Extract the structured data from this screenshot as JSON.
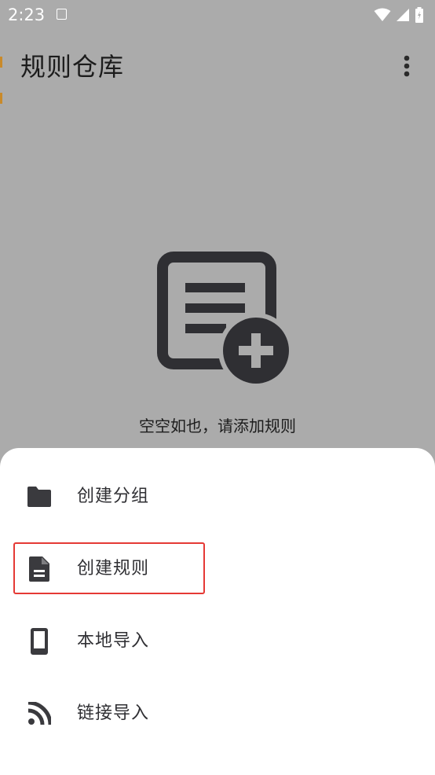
{
  "status_bar": {
    "time": "2:23",
    "icons": [
      "wifi-icon",
      "signal-icon",
      "battery-icon"
    ]
  },
  "app_bar": {
    "title": "规则仓库",
    "menu_icon": "more-vert-icon"
  },
  "empty_state": {
    "icon": "post-add-icon",
    "message": "空空如也，请添加规则"
  },
  "bottom_sheet": {
    "items": [
      {
        "label": "创建分组",
        "icon": "folder-icon"
      },
      {
        "label": "创建规则",
        "icon": "description-icon"
      },
      {
        "label": "本地导入",
        "icon": "phone-icon"
      },
      {
        "label": "链接导入",
        "icon": "rss-icon"
      }
    ]
  },
  "colors": {
    "scrim": "#ababab",
    "sheet": "#ffffff",
    "icon": "#3a3a3e",
    "highlight": "#e53935"
  }
}
